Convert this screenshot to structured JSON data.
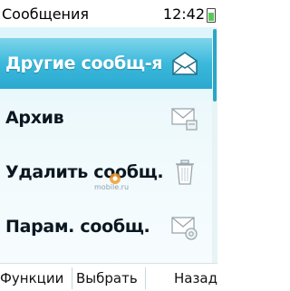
{
  "status": {
    "title": "Сообщения",
    "time": "12:42"
  },
  "menu": {
    "items": [
      {
        "label": "Другие сообщ-я",
        "icon": "envelope-open-icon",
        "selected": true
      },
      {
        "label": "Архив",
        "icon": "archive-envelope-icon",
        "selected": false
      },
      {
        "label": "Удалить сообщ.",
        "icon": "trash-icon",
        "selected": false
      },
      {
        "label": "Парам. сообщ.",
        "icon": "message-settings-icon",
        "selected": false
      }
    ]
  },
  "watermark": "mobile.ru",
  "softkeys": {
    "left": "Функции",
    "middle": "Выбрать",
    "right": "Назад"
  },
  "colors": {
    "selection": "#2aa8cf",
    "list_bg": "#dff5fb",
    "icon_gray": "#9aa7ad"
  }
}
